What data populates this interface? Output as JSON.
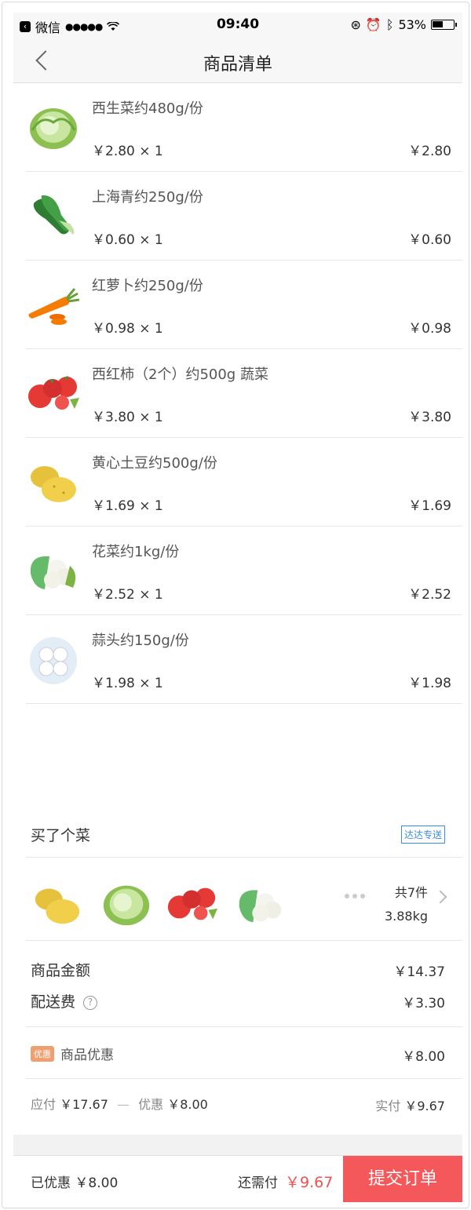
{
  "statusbar": {
    "back_app": "微信",
    "signal": "●●●●●",
    "time": "09:40",
    "battery": "53%"
  },
  "nav": {
    "title": "商品清单"
  },
  "items": [
    {
      "name": "西生菜约480g/份",
      "unit": "￥2.80 × 1",
      "total": "￥2.80",
      "icon": "lettuce-icon"
    },
    {
      "name": "上海青约250g/份",
      "unit": "￥0.60 × 1",
      "total": "￥0.60",
      "icon": "bok-choy-icon"
    },
    {
      "name": "红萝卜约250g/份",
      "unit": "￥0.98 × 1",
      "total": "￥0.98",
      "icon": "carrot-icon"
    },
    {
      "name": "西红柿（2个）约500g 蔬菜",
      "unit": "￥3.80 × 1",
      "total": "￥3.80",
      "icon": "tomato-icon"
    },
    {
      "name": "黄心土豆约500g/份",
      "unit": "￥1.69 × 1",
      "total": "￥1.69",
      "icon": "potato-icon"
    },
    {
      "name": "花菜约1kg/份",
      "unit": "￥2.52 × 1",
      "total": "￥2.52",
      "icon": "cauliflower-icon"
    },
    {
      "name": "蒜头约150g/份",
      "unit": "￥1.98 × 1",
      "total": "￥1.98",
      "icon": "garlic-icon"
    }
  ],
  "shop": {
    "name": "买了个菜",
    "badge": "达达专送",
    "count": "共7件",
    "weight": "3.88kg"
  },
  "summary": {
    "goods_label": "商品金额",
    "goods_value": "￥14.37",
    "delivery_label": "配送费",
    "delivery_value": "￥3.30",
    "discount_tag": "优惠",
    "discount_label": "商品优惠",
    "discount_value": "￥8.00",
    "payable_label": "应付",
    "payable_value": "￥17.67",
    "minus": "—",
    "off_label": "优惠",
    "off_value": "￥8.00",
    "actual_label": "实付",
    "actual_value": "￥9.67"
  },
  "bottom": {
    "saved": "已优惠 ￥8.00",
    "due_label": "还需付",
    "due_value": "￥9.67",
    "submit": "提交订单"
  },
  "colors": {
    "accent": "#f4585a",
    "price_red": "#f0504f",
    "badge_blue": "#3a8ee6"
  }
}
